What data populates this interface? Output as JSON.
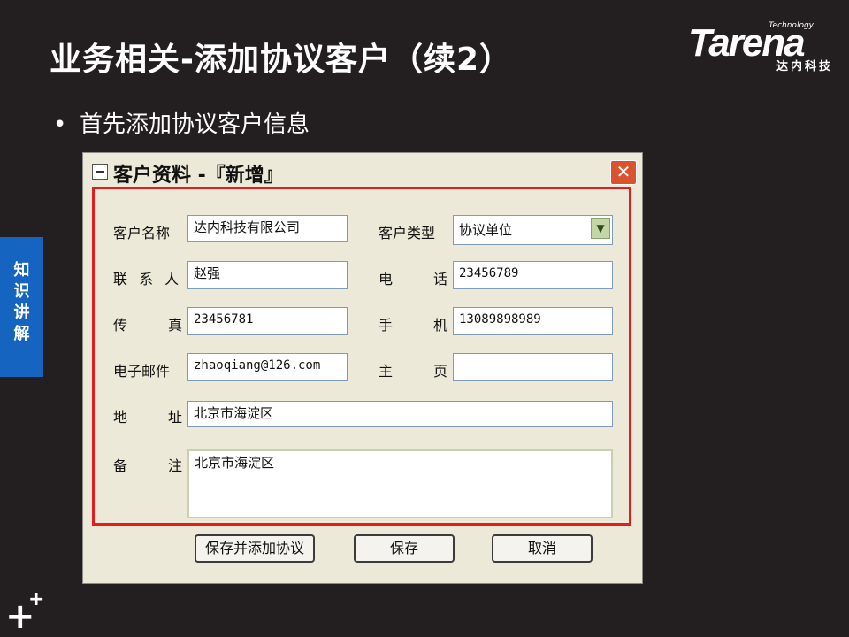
{
  "slide": {
    "title": "业务相关-添加协议客户（续2）",
    "bullet": "首先添加协议客户信息",
    "side_tab": [
      "知",
      "识",
      "讲",
      "解"
    ],
    "logo": {
      "brand": "Tarena",
      "tagline": "Technology",
      "cn": "达内科技"
    },
    "footer_mark": "+"
  },
  "dialog": {
    "title": "客户资料 -『新增』",
    "close_glyph": "✕",
    "fields": {
      "name": {
        "label": "客户名称",
        "value": "达内科技有限公司"
      },
      "type": {
        "label": "客户类型",
        "value": "协议单位"
      },
      "contact": {
        "label": "联 系 人",
        "value": "赵强"
      },
      "phone": {
        "label": "电　话",
        "value": "23456789"
      },
      "fax": {
        "label": "传　真",
        "value": "23456781"
      },
      "mobile": {
        "label": "手　机",
        "value": "13089898989"
      },
      "email": {
        "label": "电子邮件",
        "value": "zhaoqiang@126.com"
      },
      "homepage": {
        "label": "主　页",
        "value": ""
      },
      "address": {
        "label": "地　址",
        "value": "北京市海淀区"
      },
      "remark": {
        "label": "备　注",
        "value": "北京市海淀区"
      }
    },
    "buttons": {
      "save_add": "保存并添加协议",
      "save": "保存",
      "cancel": "取消"
    },
    "accent": "#e31c1c"
  }
}
